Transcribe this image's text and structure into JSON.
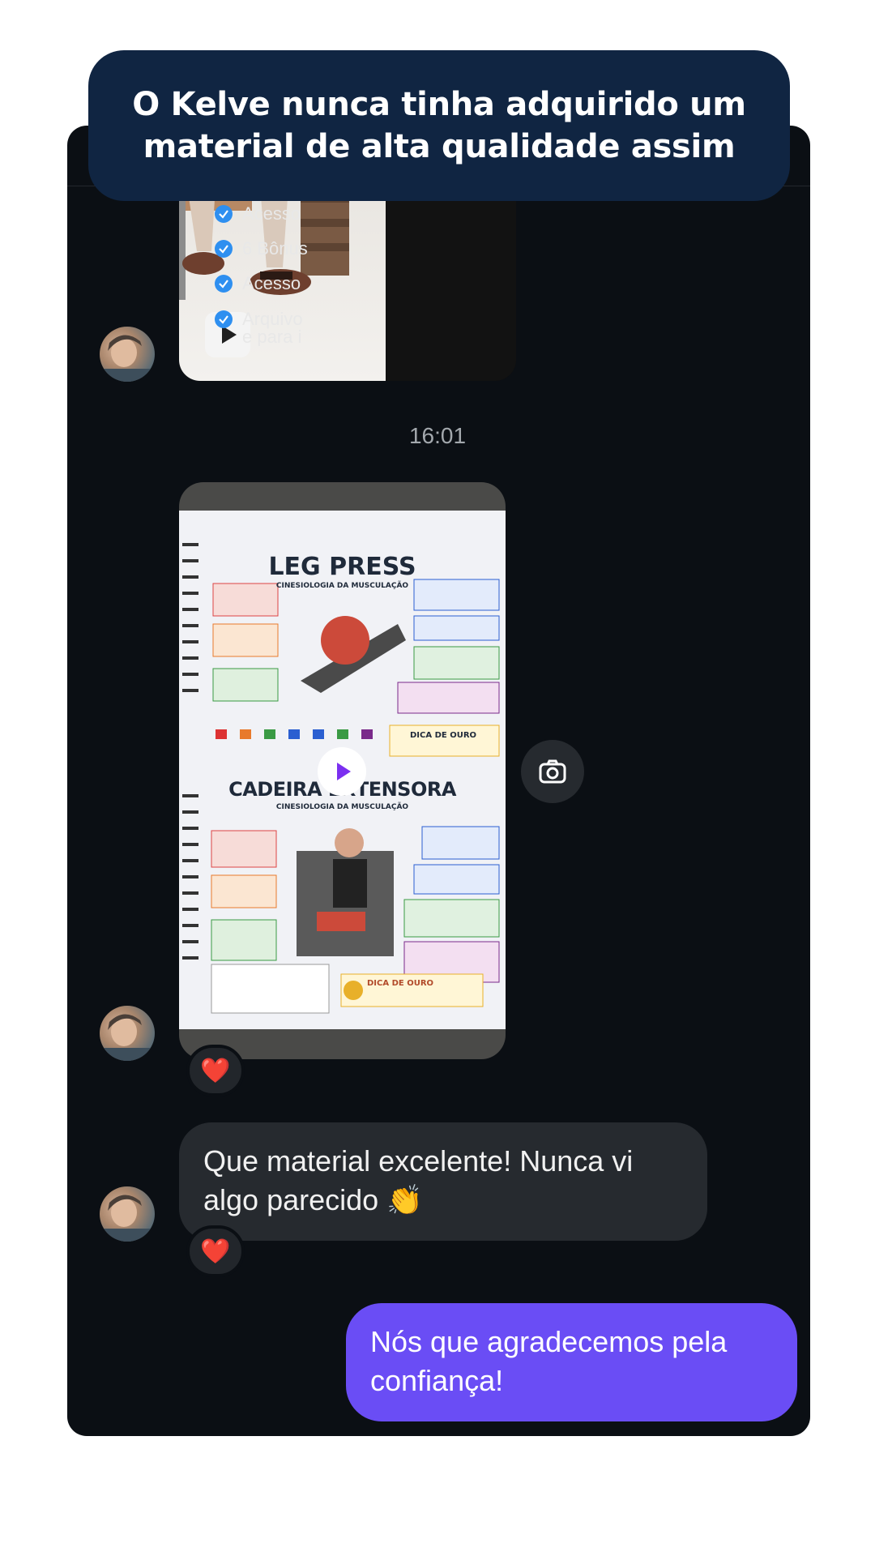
{
  "banner": {
    "text": "O Kelve nunca tinha adquirido um material de alta qualidade assim"
  },
  "thread": {
    "media1": {
      "checklist": [
        "Acesso",
        "6 Bônus",
        "Acesso",
        "Arquivo",
        "e para i"
      ]
    },
    "timestamp": "16:01",
    "media2": {
      "sheet1_title": "LEG PRESS",
      "sheet1_subtitle": "CINESIOLOGIA DA MUSCULAÇÃO",
      "sheet1_tip": "DICA DE OURO",
      "sheet2_title": "CADEIRA EXTENSORA",
      "sheet2_subtitle": "CINESIOLOGIA DA MUSCULAÇÃO",
      "sheet2_tip": "DICA DE OURO",
      "reaction": "❤️"
    },
    "incoming_message": {
      "text": "Que material excelente! Nunca vi algo parecido 👏",
      "reaction": "❤️"
    },
    "outgoing_message": {
      "text": "Nós que agradecemos pela confiança!"
    }
  },
  "colors": {
    "panel_bg": "#0b0f14",
    "banner_bg": "#102542",
    "incoming_bubble": "#262a2f",
    "outgoing_bubble": "#6a4df5",
    "check_blue": "#2e8ff0"
  },
  "icons": [
    "play-icon",
    "camera-icon",
    "check-icon",
    "heart-reaction-icon",
    "avatar"
  ]
}
